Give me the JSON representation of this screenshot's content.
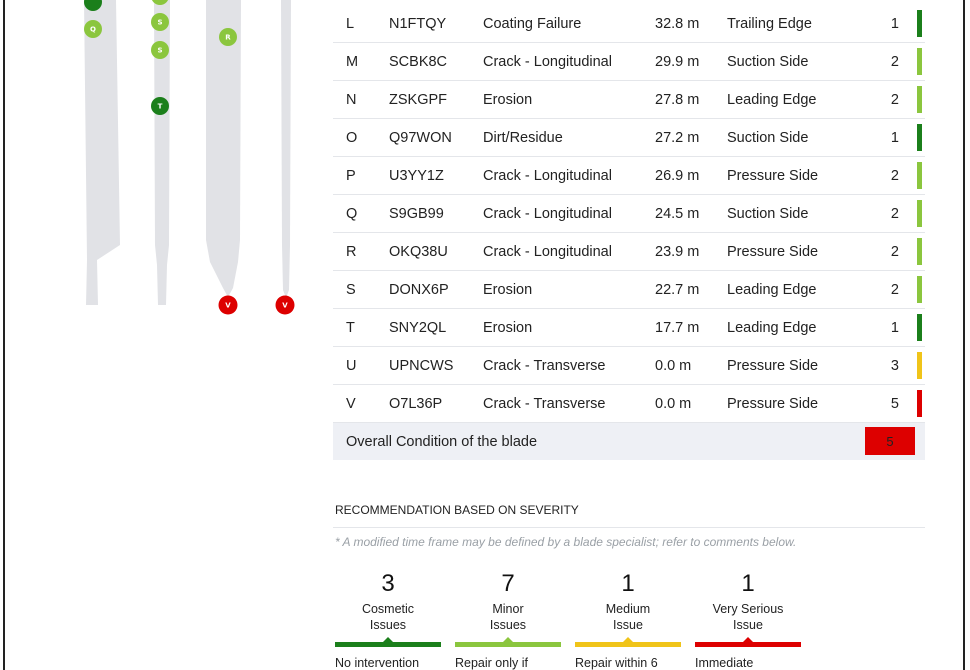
{
  "colors": {
    "severity_1": "#1b7f1b",
    "severity_2": "#8bc63e",
    "severity_3": "#f0c419",
    "severity_5": "#dd0000",
    "blade": "#e1e2e6"
  },
  "blade_markers": [
    {
      "label": "",
      "color": "#1b7f1b"
    },
    {
      "label": "Q",
      "color": "#8bc63e"
    },
    {
      "label": "",
      "color": "#8bc63e"
    },
    {
      "label": "S",
      "color": "#8bc63e"
    },
    {
      "label": "S",
      "color": "#8bc63e"
    },
    {
      "label": "R",
      "color": "#8bc63e"
    },
    {
      "label": "T",
      "color": "#1b7f1b"
    },
    {
      "label": "V",
      "color": "#dd0000"
    },
    {
      "label": "V",
      "color": "#dd0000"
    }
  ],
  "findings": [
    {
      "letter": "L",
      "id": "N1FTQY",
      "type": "Coating Failure",
      "distance": "32.8 m",
      "location": "Trailing Edge",
      "severity": "1",
      "color": "#1b7f1b"
    },
    {
      "letter": "M",
      "id": "SCBK8C",
      "type": "Crack - Longitudinal",
      "distance": "29.9 m",
      "location": "Suction Side",
      "severity": "2",
      "color": "#8bc63e"
    },
    {
      "letter": "N",
      "id": "ZSKGPF",
      "type": "Erosion",
      "distance": "27.8 m",
      "location": "Leading Edge",
      "severity": "2",
      "color": "#8bc63e"
    },
    {
      "letter": "O",
      "id": "Q97WON",
      "type": "Dirt/Residue",
      "distance": "27.2 m",
      "location": "Suction Side",
      "severity": "1",
      "color": "#1b7f1b"
    },
    {
      "letter": "P",
      "id": "U3YY1Z",
      "type": "Crack - Longitudinal",
      "distance": "26.9 m",
      "location": "Pressure Side",
      "severity": "2",
      "color": "#8bc63e"
    },
    {
      "letter": "Q",
      "id": "S9GB99",
      "type": "Crack - Longitudinal",
      "distance": "24.5 m",
      "location": "Suction Side",
      "severity": "2",
      "color": "#8bc63e"
    },
    {
      "letter": "R",
      "id": "OKQ38U",
      "type": "Crack - Longitudinal",
      "distance": "23.9 m",
      "location": "Pressure Side",
      "severity": "2",
      "color": "#8bc63e"
    },
    {
      "letter": "S",
      "id": "DONX6P",
      "type": "Erosion",
      "distance": "22.7 m",
      "location": "Leading Edge",
      "severity": "2",
      "color": "#8bc63e"
    },
    {
      "letter": "T",
      "id": "SNY2QL",
      "type": "Erosion",
      "distance": "17.7 m",
      "location": "Leading Edge",
      "severity": "1",
      "color": "#1b7f1b"
    },
    {
      "letter": "U",
      "id": "UPNCWS",
      "type": "Crack - Transverse",
      "distance": "0.0 m",
      "location": "Pressure Side",
      "severity": "3",
      "color": "#f0c419"
    },
    {
      "letter": "V",
      "id": "O7L36P",
      "type": "Crack - Transverse",
      "distance": "0.0 m",
      "location": "Pressure Side",
      "severity": "5",
      "color": "#dd0000"
    }
  ],
  "overall": {
    "label": "Overall Condition of the blade",
    "value": "5"
  },
  "recommendation": {
    "title": "RECOMMENDATION BASED ON SEVERITY",
    "note": "* A modified time frame may be defined by a blade specialist; refer to comments below.",
    "cards": [
      {
        "count": "3",
        "label_1": "Cosmetic",
        "label_2": "Issues",
        "action": "No intervention",
        "color": "#1b7f1b"
      },
      {
        "count": "7",
        "label_1": "Minor",
        "label_2": "Issues",
        "action": "Repair only if",
        "color": "#8bc63e"
      },
      {
        "count": "1",
        "label_1": "Medium",
        "label_2": "Issue",
        "action": "Repair within 6",
        "color": "#f0c419"
      },
      {
        "count": "1",
        "label_1": "Very Serious",
        "label_2": "Issue",
        "action": "Immediate",
        "color": "#dd0000"
      }
    ]
  }
}
